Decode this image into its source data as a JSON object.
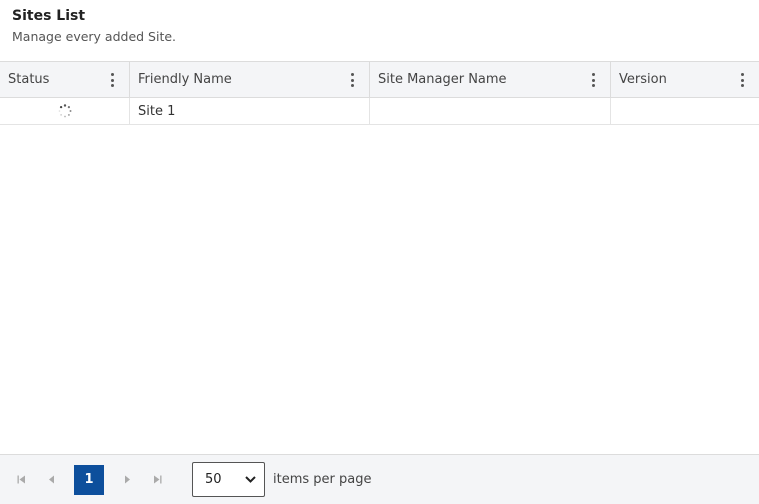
{
  "header": {
    "title": "Sites List",
    "subtitle": "Manage every added Site."
  },
  "table": {
    "columns": [
      "Status",
      "Friendly Name",
      "Site Manager Name",
      "Version"
    ],
    "rows": [
      {
        "status_icon": "loading-spinner-icon",
        "friendly_name": "Site 1",
        "site_manager_name": "",
        "version": ""
      }
    ]
  },
  "pager": {
    "current_page": "1",
    "page_size": "50",
    "items_per_page_label": "items per page"
  },
  "colors": {
    "accent": "#0d4f9c",
    "header_bg": "#f4f5f7",
    "border": "#dcdcdc"
  }
}
